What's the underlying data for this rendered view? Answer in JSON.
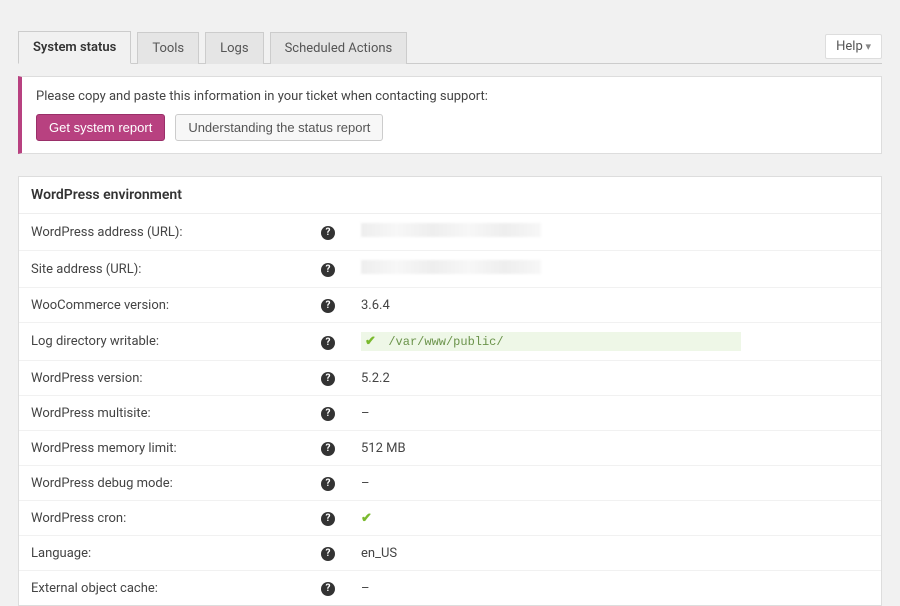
{
  "help_label": "Help",
  "tabs": {
    "system_status": "System status",
    "tools": "Tools",
    "logs": "Logs",
    "scheduled_actions": "Scheduled Actions"
  },
  "notice": {
    "text": "Please copy and paste this information in your ticket when contacting support:",
    "get_report": "Get system report",
    "understanding": "Understanding the status report"
  },
  "panel_title": "WordPress environment",
  "rows": {
    "wp_address": {
      "label": "WordPress address (URL):"
    },
    "site_address": {
      "label": "Site address (URL):"
    },
    "wc_version": {
      "label": "WooCommerce version:",
      "value": "3.6.4"
    },
    "log_dir": {
      "label": "Log directory writable:",
      "path": "/var/www/public/"
    },
    "wp_version": {
      "label": "WordPress version:",
      "value": "5.2.2"
    },
    "wp_multisite": {
      "label": "WordPress multisite:",
      "value": "–"
    },
    "wp_memory": {
      "label": "WordPress memory limit:",
      "value": "512 MB"
    },
    "wp_debug": {
      "label": "WordPress debug mode:",
      "value": "–"
    },
    "wp_cron": {
      "label": "WordPress cron:"
    },
    "language": {
      "label": "Language:",
      "value": "en_US"
    },
    "ext_cache": {
      "label": "External object cache:",
      "value": "–"
    }
  }
}
